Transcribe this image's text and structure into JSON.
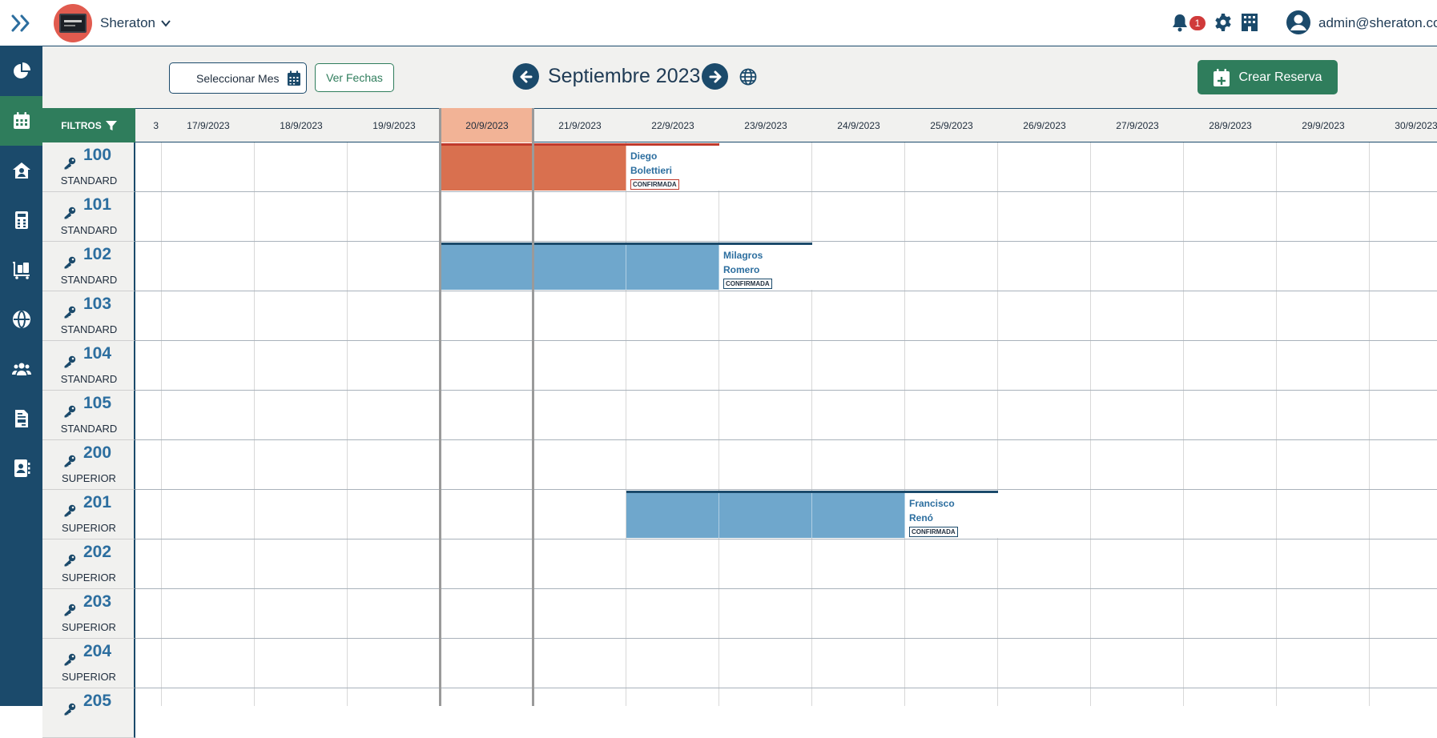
{
  "topbar": {
    "hotel_name": "Sheraton",
    "notifications_count": "1",
    "user_email": "admin@sheraton.com"
  },
  "sidebar": {
    "items": [
      {
        "icon": "pie-chart-icon"
      },
      {
        "icon": "calendar-icon",
        "active": true
      },
      {
        "icon": "house-user-icon"
      },
      {
        "icon": "calculator-icon"
      },
      {
        "icon": "luggage-cart-icon"
      },
      {
        "icon": "globe-icon"
      },
      {
        "icon": "users-icon"
      },
      {
        "icon": "file-invoice-icon"
      },
      {
        "icon": "address-book-icon"
      }
    ]
  },
  "toolbar": {
    "month_placeholder": "Seleccionar Mes",
    "ver_fechas_label": "Ver Fechas",
    "month_title": "Septiembre 2023",
    "crear_reserva_label": "Crear Reserva"
  },
  "grid": {
    "filters_label": "FILTROS",
    "partial_first_label": "3",
    "dates": [
      "17/9/2023",
      "18/9/2023",
      "19/9/2023",
      "20/9/2023",
      "21/9/2023",
      "22/9/2023",
      "23/9/2023",
      "24/9/2023",
      "25/9/2023",
      "26/9/2023",
      "27/9/2023",
      "28/9/2023",
      "29/9/2023",
      "30/9/2023"
    ],
    "today": "20/9/2023",
    "rooms": [
      {
        "number": "100",
        "type": "STANDARD"
      },
      {
        "number": "101",
        "type": "STANDARD"
      },
      {
        "number": "102",
        "type": "STANDARD"
      },
      {
        "number": "103",
        "type": "STANDARD"
      },
      {
        "number": "104",
        "type": "STANDARD"
      },
      {
        "number": "105",
        "type": "STANDARD"
      },
      {
        "number": "200",
        "type": "SUPERIOR"
      },
      {
        "number": "201",
        "type": "SUPERIOR"
      },
      {
        "number": "202",
        "type": "SUPERIOR"
      },
      {
        "number": "203",
        "type": "SUPERIOR"
      },
      {
        "number": "204",
        "type": "SUPERIOR"
      },
      {
        "number": "205",
        "type": ""
      }
    ],
    "reservations": [
      {
        "room": "100",
        "guest_first": "Diego",
        "guest_last": "Bolettieri",
        "status": "CONFIRMADA",
        "start": "20/9/2023",
        "end": "22/9/2023",
        "color": "#d9704f",
        "status_color": "#c0392b"
      },
      {
        "room": "102",
        "guest_first": "Milagros",
        "guest_last": "Romero",
        "status": "CONFIRMADA",
        "start": "20/9/2023",
        "end": "23/9/2023",
        "color": "#6fa7cc",
        "status_color": "#1b4a6b"
      },
      {
        "room": "201",
        "guest_first": "Francisco",
        "guest_last": "Renó",
        "status": "CONFIRMADA",
        "start": "22/9/2023",
        "end": "25/9/2023",
        "color": "#6fa7cc",
        "status_color": "#1b4a6b"
      }
    ]
  },
  "colors": {
    "primary": "#1b4a6b",
    "accent_green": "#2f7d5c",
    "today_highlight": "#f2b396"
  }
}
